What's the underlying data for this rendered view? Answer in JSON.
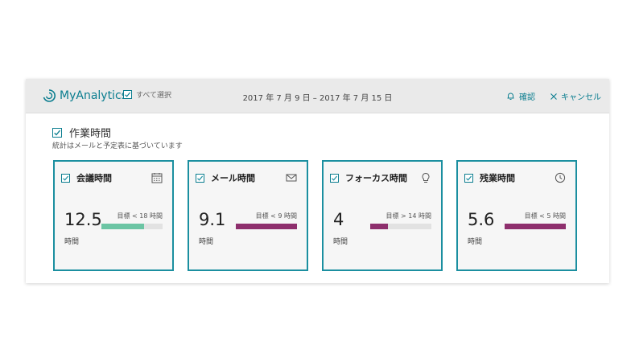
{
  "header": {
    "brand": "MyAnalytics",
    "select_all": "すべて選択",
    "date_range": "2017 年 7 月 9 日 – 2017 年 7 月 15 日",
    "confirm": "確認",
    "cancel": "キャンセル"
  },
  "section": {
    "title": "作業時間",
    "subtitle": "統計はメールと予定表に基づいています"
  },
  "colors": {
    "accent": "#1b8fa0",
    "on_track": "#6cc5a4",
    "over": "#8e2f6d",
    "track": "#e2e2e2"
  },
  "cards": [
    {
      "title": "会議時間",
      "icon": "calendar-icon",
      "value": "12.5",
      "unit": "時間",
      "goal": "目標 < 18 時間",
      "progress": 0.7,
      "bar_color": "#6cc5a4"
    },
    {
      "title": "メール時間",
      "icon": "envelope-icon",
      "value": "9.1",
      "unit": "時間",
      "goal": "目標 < 9 時間",
      "progress": 1.0,
      "bar_color": "#8e2f6d"
    },
    {
      "title": "フォーカス時間",
      "icon": "lightbulb-icon",
      "value": "4",
      "unit": "時間",
      "goal": "目標 > 14 時間",
      "progress": 0.29,
      "bar_color": "#8e2f6d"
    },
    {
      "title": "残業時間",
      "icon": "clock-icon",
      "value": "5.6",
      "unit": "時間",
      "goal": "目標 < 5 時間",
      "progress": 1.0,
      "bar_color": "#8e2f6d"
    }
  ]
}
